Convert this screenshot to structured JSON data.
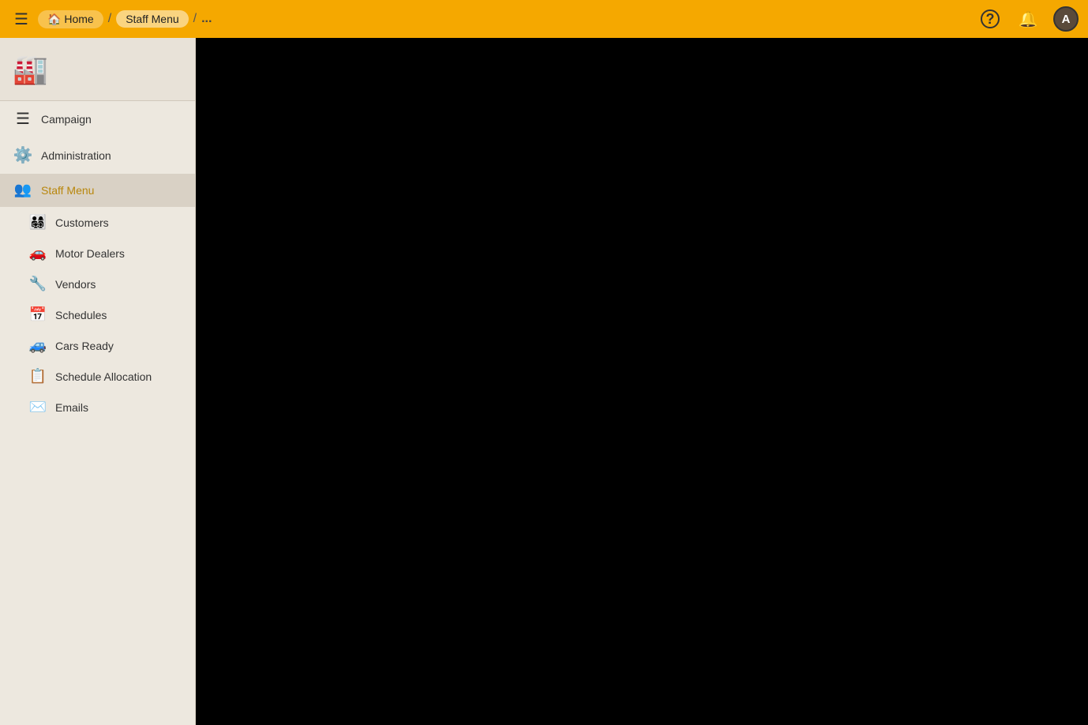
{
  "header": {
    "hamburger_label": "☰",
    "breadcrumbs": [
      {
        "label": "Home",
        "icon": "🏠",
        "active": false
      },
      {
        "label": "Staff Menu",
        "active": true
      }
    ],
    "breadcrumb_separator": "/",
    "breadcrumb_more": "...",
    "help_icon": "?",
    "notification_icon": "🔔",
    "avatar_label": "A"
  },
  "sidebar": {
    "logo_icon": "🏭",
    "nav_items": [
      {
        "id": "campaign",
        "label": "Campaign",
        "icon": "☰",
        "type": "top"
      },
      {
        "id": "administration",
        "label": "Administration",
        "icon": "⚙",
        "type": "top"
      },
      {
        "id": "staff-menu",
        "label": "Staff Menu",
        "icon": "👥",
        "type": "top",
        "active": true
      }
    ],
    "sub_items": [
      {
        "id": "customers",
        "label": "Customers",
        "icon": "👨‍👩‍👧‍👦"
      },
      {
        "id": "motor-dealers",
        "label": "Motor Dealers",
        "icon": "🚗"
      },
      {
        "id": "vendors",
        "label": "Vendors",
        "icon": "🔧"
      },
      {
        "id": "schedules",
        "label": "Schedules",
        "icon": "📅"
      },
      {
        "id": "cars-ready",
        "label": "Cars Ready",
        "icon": "🚙"
      },
      {
        "id": "schedule-allocation",
        "label": "Schedule Allocation",
        "icon": "📋"
      },
      {
        "id": "emails",
        "label": "Emails",
        "icon": "✉"
      }
    ]
  }
}
